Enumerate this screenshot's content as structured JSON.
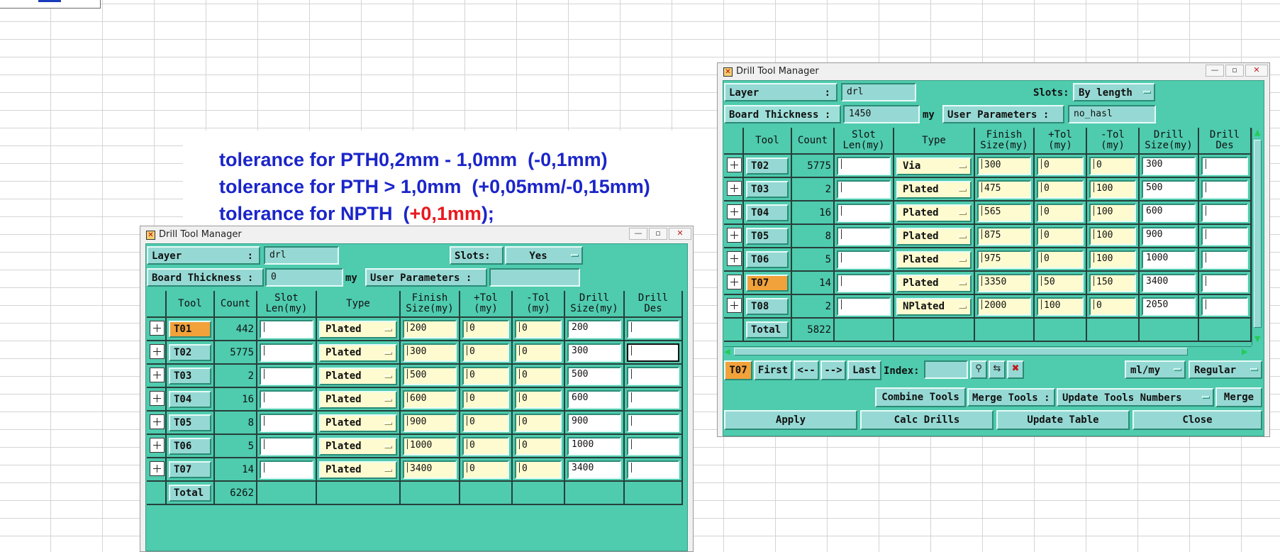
{
  "notes": {
    "line1": "tolerance for PTH0,2mm - 1,0mm  (-0,1mm)",
    "line2": "tolerance for PTH > 1,0mm  (+0,05mm/-0,15mm)",
    "line3_blue": "tolerance for NPTH  (",
    "line3_red": "+0,1mm",
    "line3_end": ");"
  },
  "win_front": {
    "title": "Drill Tool Manager",
    "layer_label": "Layer",
    "layer_colon": ":",
    "layer_value": "drl",
    "slots_label": "Slots:",
    "slots_value": "Yes",
    "thickness_label": "Board Thickness :",
    "thickness_value": "0",
    "thickness_unit": "my",
    "user_params_label": "User Parameters :",
    "user_params_value": "",
    "headers": [
      "Tool",
      "Count",
      "Slot\nLen(my)",
      "Type",
      "Finish\nSize(my)",
      "+Tol\n(my)",
      "-Tol\n(my)",
      "Drill\nSize(my)",
      "Drill\nDes"
    ],
    "rows": [
      {
        "tool": "T01",
        "count": "442",
        "type": "Plated",
        "finish": "200",
        "ptol": "0",
        "mtol": "0",
        "drill": "200"
      },
      {
        "tool": "T02",
        "count": "5775",
        "type": "Plated",
        "finish": "300",
        "ptol": "0",
        "mtol": "0",
        "drill": "300"
      },
      {
        "tool": "T03",
        "count": "2",
        "type": "Plated",
        "finish": "500",
        "ptol": "0",
        "mtol": "0",
        "drill": "500"
      },
      {
        "tool": "T04",
        "count": "16",
        "type": "Plated",
        "finish": "600",
        "ptol": "0",
        "mtol": "0",
        "drill": "600"
      },
      {
        "tool": "T05",
        "count": "8",
        "type": "Plated",
        "finish": "900",
        "ptol": "0",
        "mtol": "0",
        "drill": "900"
      },
      {
        "tool": "T06",
        "count": "5",
        "type": "Plated",
        "finish": "1000",
        "ptol": "0",
        "mtol": "0",
        "drill": "1000"
      },
      {
        "tool": "T07",
        "count": "14",
        "type": "Plated",
        "finish": "3400",
        "ptol": "0",
        "mtol": "0",
        "drill": "3400"
      }
    ],
    "total_label": "Total",
    "total_value": "6262"
  },
  "win_back": {
    "title": "Drill Tool Manager",
    "layer_label": "Layer",
    "layer_colon": ":",
    "layer_value": "drl",
    "slots_label": "Slots:",
    "slots_value": "By length",
    "thickness_label": "Board Thickness :",
    "thickness_value": "1450",
    "thickness_unit": "my",
    "user_params_label": "User Parameters :",
    "user_params_value": "no_hasl",
    "headers": [
      "Tool",
      "Count",
      "Slot\nLen(my)",
      "Type",
      "Finish\nSize(my)",
      "+Tol\n(my)",
      "-Tol\n(my)",
      "Drill\nSize(my)",
      "Drill\nDes"
    ],
    "rows": [
      {
        "tool": "T02",
        "count": "5775",
        "type": "Via",
        "finish": "300",
        "ptol": "0",
        "mtol": "0",
        "drill": "300"
      },
      {
        "tool": "T03",
        "count": "2",
        "type": "Plated",
        "finish": "475",
        "ptol": "0",
        "mtol": "100",
        "drill": "500"
      },
      {
        "tool": "T04",
        "count": "16",
        "type": "Plated",
        "finish": "565",
        "ptol": "0",
        "mtol": "100",
        "drill": "600"
      },
      {
        "tool": "T05",
        "count": "8",
        "type": "Plated",
        "finish": "875",
        "ptol": "0",
        "mtol": "100",
        "drill": "900"
      },
      {
        "tool": "T06",
        "count": "5",
        "type": "Plated",
        "finish": "975",
        "ptol": "0",
        "mtol": "100",
        "drill": "1000"
      },
      {
        "tool": "T07",
        "count": "14",
        "type": "Plated",
        "finish": "3350",
        "ptol": "50",
        "mtol": "150",
        "drill": "3400"
      },
      {
        "tool": "T08",
        "count": "2",
        "type": "NPlated",
        "finish": "2000",
        "ptol": "100",
        "mtol": "0",
        "drill": "2050"
      }
    ],
    "total_label": "Total",
    "total_value": "5822",
    "nav": {
      "current_tool": "T07",
      "first": "First",
      "prev": "<--",
      "next": "-->",
      "last": "Last",
      "index_label": "Index:",
      "index_value": "",
      "units": "ml/my",
      "mode": "Regular"
    },
    "merge_row": {
      "combine": "Combine Tools",
      "merge_label": "Merge Tools :",
      "update_numbers": "Update Tools Numbers",
      "merge": "Merge"
    },
    "actions": {
      "apply": "Apply",
      "calc": "Calc Drills",
      "update": "Update Table",
      "close": "Close"
    }
  }
}
